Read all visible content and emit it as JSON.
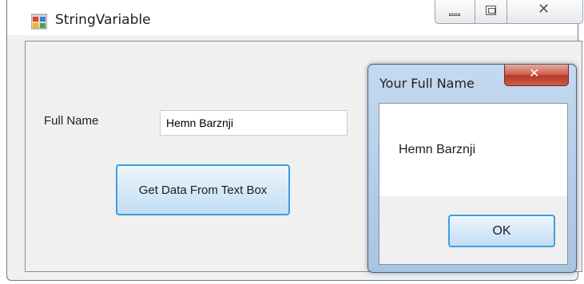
{
  "window": {
    "title": "StringVariable",
    "icon": "winforms-app-icon",
    "controls": {
      "minimize": "minimize-icon",
      "maximize": "maximize-icon",
      "close": "✕"
    }
  },
  "form": {
    "label": "Full Name",
    "input_value": "Hemn Barznji",
    "button_label": "Get Data From Text Box"
  },
  "message_box": {
    "title": "Your Full Name",
    "close_glyph": "✕",
    "message": "Hemn Barznji",
    "ok_label": "OK"
  },
  "colors": {
    "focus_border": "#3c9fdf",
    "close_button_red": "#c44b3a",
    "dialog_frame": "#b9d1ea"
  }
}
